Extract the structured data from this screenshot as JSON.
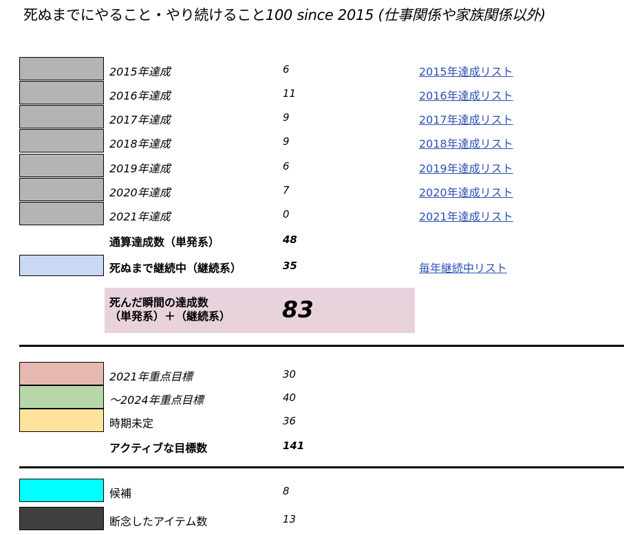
{
  "title": {
    "main": "死ぬまでにやること・やり続けること",
    "num": "100 since 2015",
    "suffix": " (仕事関係や家族関係以外)"
  },
  "colors": {
    "gray": "#b4b4b4",
    "blue": "#c9d9f4",
    "pink": "#e8d3dd",
    "red": "#e6b8b2",
    "green": "#b6d8a8",
    "yellow": "#fde39c",
    "cyan": "#00ffff",
    "dark": "#3f3f3f",
    "link": "#2c4fb4"
  },
  "yearly": [
    {
      "label": "2015年達成",
      "value": "6",
      "link": "2015年達成リスト"
    },
    {
      "label": "2016年達成",
      "value": "11",
      "link": "2016年達成リスト"
    },
    {
      "label": "2017年達成",
      "value": "9",
      "link": "2017年達成リスト"
    },
    {
      "label": "2018年達成",
      "value": "9",
      "link": "2018年達成リスト"
    },
    {
      "label": "2019年達成",
      "value": "6",
      "link": "2019年達成リスト"
    },
    {
      "label": "2020年達成",
      "value": "7",
      "link": "2020年達成リスト"
    },
    {
      "label": "2021年達成",
      "value": "0",
      "link": "2021年達成リスト"
    }
  ],
  "total_single": {
    "label": "通算達成数（単発系）",
    "value": "48"
  },
  "continuing": {
    "label": "死ぬまで継続中（継続系）",
    "value": "35",
    "link": "毎年継続中リスト"
  },
  "death_total": {
    "label": "死んだ瞬間の達成数\n（単発系）＋（継続系）",
    "value": "83"
  },
  "goals": [
    {
      "label": "2021年重点目標",
      "value": "30"
    },
    {
      "label": "～2024年重点目標",
      "value": "40"
    },
    {
      "label": "時期未定",
      "value": "36"
    }
  ],
  "active_total": {
    "label": "アクティブな目標数",
    "value": "141"
  },
  "others": [
    {
      "label": "候補",
      "value": "8"
    },
    {
      "label": "断念したアイテム数",
      "value": "13"
    }
  ]
}
